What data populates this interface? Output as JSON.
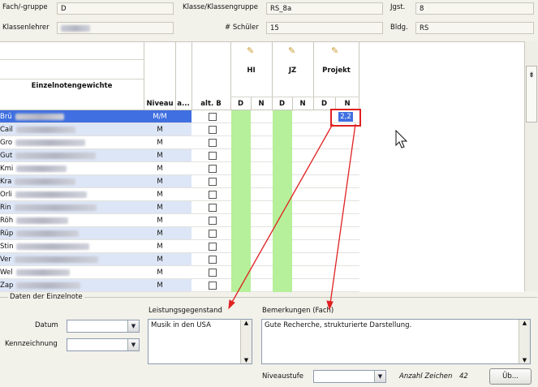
{
  "header": {
    "fach_label": "Fach/-gruppe",
    "fach_value": "D",
    "klasse_label": "Klasse/Klassengruppe",
    "klasse_value": "RS_8a",
    "jgst_label": "Jgst.",
    "jgst_value": "8",
    "klassenlehrer_label": "Klassenlehrer",
    "schueler_label": "# Schüler",
    "schueler_value": "15",
    "bldg_label": "Bldg.",
    "bldg_value": "RS"
  },
  "grid": {
    "title": "Einzelnotengewichte",
    "col_niveau": "Niveau",
    "col_a": "a...",
    "col_altb": "alt. B",
    "groups": [
      {
        "name": "HI",
        "d": "D",
        "n": "N"
      },
      {
        "name": "JZ",
        "d": "D",
        "n": "N"
      },
      {
        "name": "Projekt",
        "d": "D",
        "n": "N"
      }
    ],
    "rows": [
      {
        "name": "Brü",
        "niveau": "M/M",
        "selected": true,
        "projekt_n": "2,2"
      },
      {
        "name": "Cail",
        "niveau": "M"
      },
      {
        "name": "Gro",
        "niveau": "M"
      },
      {
        "name": "Gut",
        "niveau": "M"
      },
      {
        "name": "Kmi",
        "niveau": "M"
      },
      {
        "name": "Kra",
        "niveau": "M"
      },
      {
        "name": "Orli",
        "niveau": "M"
      },
      {
        "name": "Rin",
        "niveau": "M"
      },
      {
        "name": "Röh",
        "niveau": "M"
      },
      {
        "name": "Rüp",
        "niveau": "M"
      },
      {
        "name": "Stin",
        "niveau": "M"
      },
      {
        "name": "Ver",
        "niveau": "M"
      },
      {
        "name": "Wel",
        "niveau": "M"
      },
      {
        "name": "Zap",
        "niveau": "M"
      }
    ]
  },
  "details": {
    "section_title": "Daten der Einzelnote",
    "datum_label": "Datum",
    "kennzeichnung_label": "Kennzeichnung",
    "leistung_label": "Leistungsgegenstand",
    "leistung_value": "Musik in den USA",
    "bemerkung_label": "Bemerkungen (Fach)",
    "bemerkung_value": "Gute Recherche, strukturierte Darstellung.",
    "niveaustufe_label": "Niveaustufe",
    "anzahl_label": "Anzahl Zeichen",
    "anzahl_value": "42",
    "ueb_button": "Üb..."
  },
  "colors": {
    "selected_row": "#3f6fe0",
    "alt_row": "#dde6f6",
    "green_cell": "#b6f09a",
    "annotation_red": "#e02020"
  }
}
